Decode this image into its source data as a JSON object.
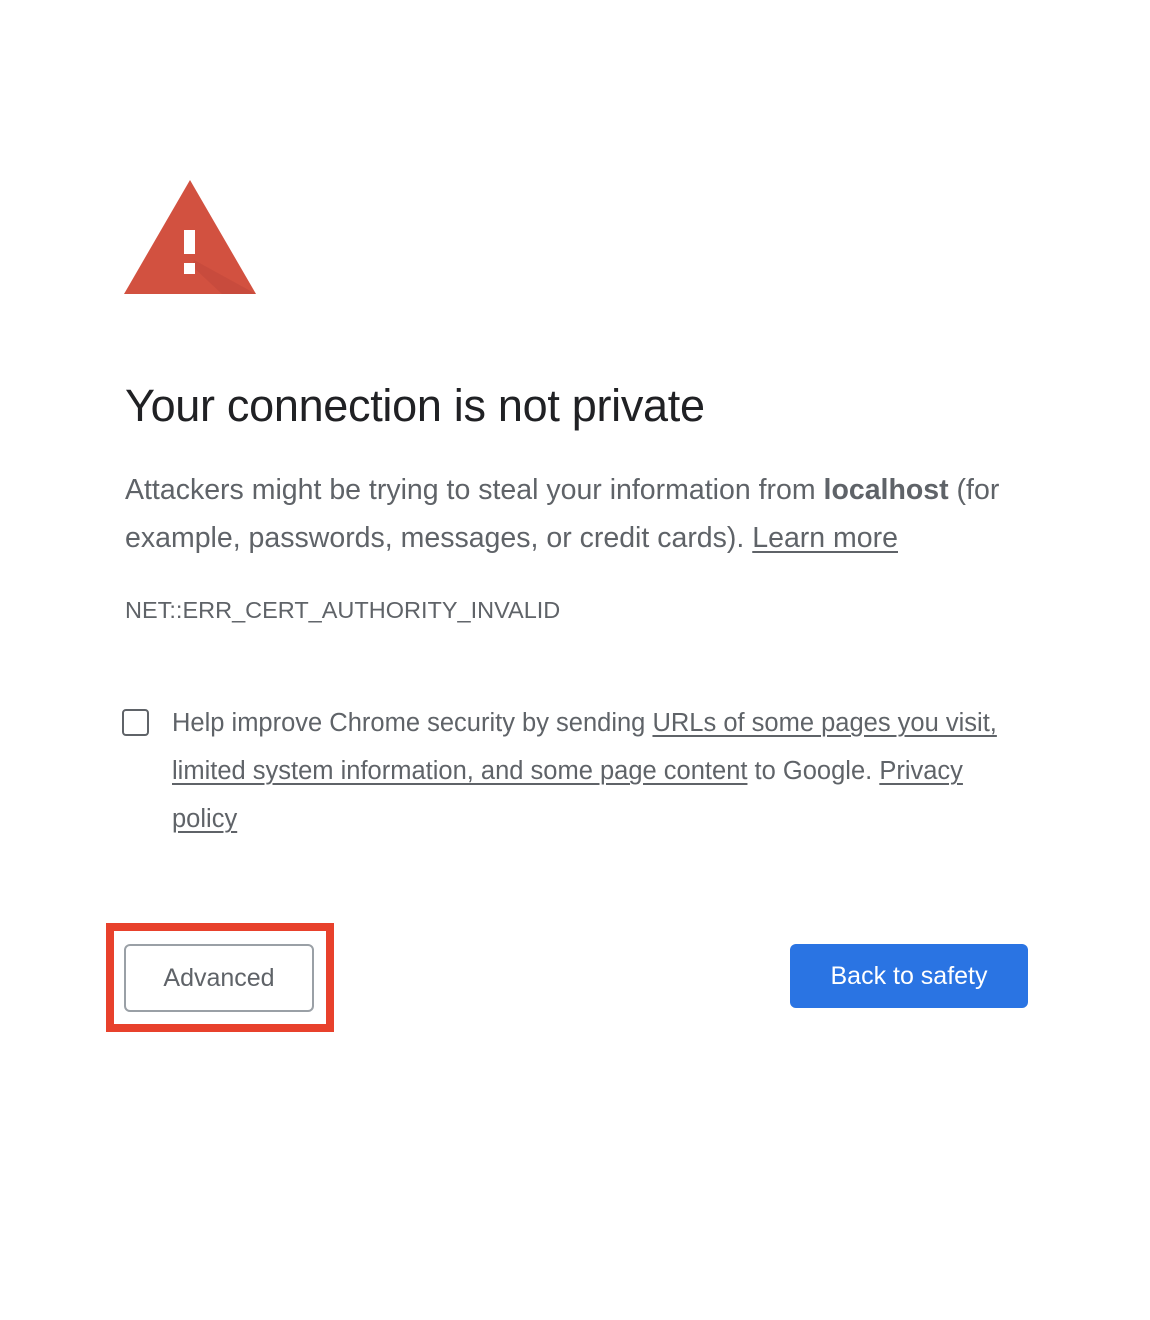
{
  "heading": "Your connection is not private",
  "explanation": {
    "prefix": "Attackers might be trying to steal your information from ",
    "host": "localhost",
    "suffix": " (for example, passwords, messages, or credit cards). ",
    "learn_more": "Learn more"
  },
  "error_code": "NET::ERR_CERT_AUTHORITY_INVALID",
  "optin": {
    "checked": false,
    "prefix": "Help improve Chrome security by sending ",
    "link": "URLs of some pages you visit, limited system information, and some page content",
    "suffix": " to Google. ",
    "privacy_link": "Privacy policy"
  },
  "buttons": {
    "advanced": "Advanced",
    "primary": "Back to safety"
  },
  "icons": {
    "warning": "warning-triangle-icon"
  },
  "colors": {
    "warning_red": "#d25140",
    "primary_blue": "#2a74e3",
    "highlight": "#e8412c",
    "heading": "#202124",
    "body_text": "#5f6368"
  }
}
